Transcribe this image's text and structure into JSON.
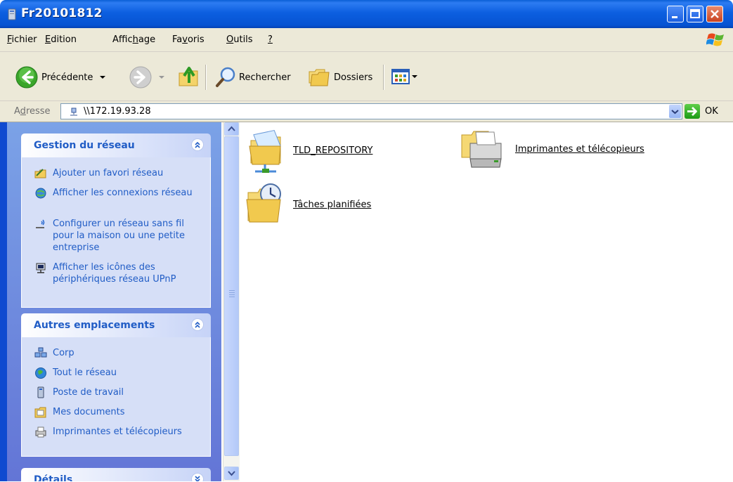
{
  "window": {
    "title": "Fr20101812"
  },
  "menubar": {
    "items": [
      {
        "pre": "",
        "ul": "F",
        "post": "ichier"
      },
      {
        "pre": "",
        "ul": "E",
        "post": "dition"
      },
      {
        "pre": "Affic",
        "ul": "h",
        "post": "age"
      },
      {
        "pre": "Fa",
        "ul": "v",
        "post": "oris"
      },
      {
        "pre": "",
        "ul": "O",
        "post": "utils"
      },
      {
        "pre": "",
        "ul": "?",
        "post": ""
      }
    ]
  },
  "toolbar": {
    "back_label": "Précédente",
    "search_label": "Rechercher",
    "folders_label": "Dossiers"
  },
  "address": {
    "label_pre": "A",
    "label_ul": "d",
    "label_post": "resse",
    "value": "\\\\172.19.93.28",
    "go_label": "OK"
  },
  "network_tasks": {
    "title": "Gestion du réseau",
    "items": [
      {
        "label": "Ajouter un favori réseau",
        "icon": "add-network-place-icon"
      },
      {
        "label": "Afficher les connexions réseau",
        "icon": "network-connections-icon"
      },
      {
        "label": "Configurer un réseau sans fil pour la maison ou une petite entreprise",
        "icon": "wireless-setup-icon"
      },
      {
        "label": "Afficher les icônes des périphériques réseau UPnP",
        "icon": "upnp-device-icon"
      }
    ]
  },
  "other_places": {
    "title": "Autres emplacements",
    "items": [
      {
        "label": "Corp",
        "icon": "workgroup-icon"
      },
      {
        "label": "Tout le réseau",
        "icon": "globe-network-icon"
      },
      {
        "label": "Poste de travail",
        "icon": "my-computer-icon"
      },
      {
        "label": "Mes documents",
        "icon": "my-documents-icon"
      },
      {
        "label": "Imprimantes et télécopieurs",
        "icon": "printers-icon"
      }
    ]
  },
  "details": {
    "title": "Détails"
  },
  "content": {
    "items": [
      {
        "label": "TLD_REPOSITORY",
        "icon": "shared-folder-icon"
      },
      {
        "label": "Imprimantes et télécopieurs",
        "icon": "printers-faxes-folder-icon"
      },
      {
        "label": "Tâches planifiées",
        "icon": "scheduled-tasks-folder-icon"
      }
    ]
  },
  "colors": {
    "titlebar": "#0653d2",
    "taskpane": "#6f8ee0",
    "link": "#215dc6"
  }
}
